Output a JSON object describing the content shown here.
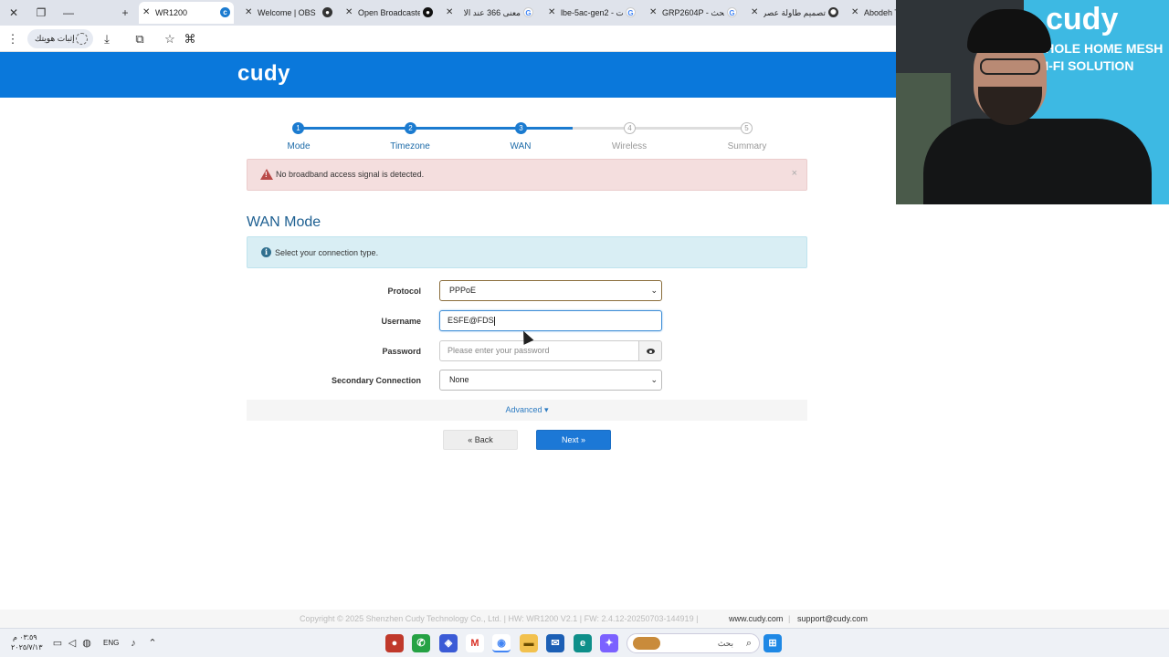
{
  "browser": {
    "tabs": [
      {
        "title": "WR1200",
        "active": true,
        "favicon": "cudy-icon"
      },
      {
        "title": "Welcome | OBS",
        "active": false,
        "favicon": "obs-icon"
      },
      {
        "title": "Open Broadcaste",
        "active": false,
        "favicon": "github-icon"
      },
      {
        "title": "معنی 366 عند الا",
        "active": false,
        "favicon": "google-icon"
      },
      {
        "title": "lbe-5ac-gen2 - ت",
        "active": false,
        "favicon": "google-icon"
      },
      {
        "title": "GRP2604P - بحث",
        "active": false,
        "favicon": "google-icon"
      },
      {
        "title": "تصميم طاولة عصر",
        "active": false,
        "favicon": "openai-icon"
      },
      {
        "title": "Abodeh T",
        "active": false,
        "favicon": "none"
      }
    ],
    "new_tab": "+",
    "toolbar": {
      "identity_label": "إثبات هويتك"
    }
  },
  "header": {
    "logo": "cudy",
    "accent": "#0a78db"
  },
  "stepper": {
    "steps": [
      {
        "num": "1",
        "label": "Mode",
        "done": true
      },
      {
        "num": "2",
        "label": "Timezone",
        "done": true
      },
      {
        "num": "3",
        "label": "WAN",
        "done": true
      },
      {
        "num": "4",
        "label": "Wireless",
        "done": false
      },
      {
        "num": "5",
        "label": "Summary",
        "done": false
      }
    ]
  },
  "alert_danger": {
    "message": "No broadband access signal is detected.",
    "close": "×"
  },
  "page_title": "WAN Mode",
  "alert_info": {
    "message": "Select your connection type."
  },
  "form": {
    "protocol": {
      "label": "Protocol",
      "value": "PPPoE"
    },
    "username": {
      "label": "Username",
      "value": "ESFE@FDS"
    },
    "password": {
      "label": "Password",
      "placeholder": "Please enter your password"
    },
    "secondary": {
      "label": "Secondary Connection",
      "value": "None"
    },
    "advanced": "Advanced ▾",
    "back": "« Back",
    "next": "Next »"
  },
  "footer": {
    "copyright": "Copyright © 2025 Shenzhen Cudy Technology Co., Ltd.  |  HW: WR1200 V2.1  |  FW: 2.4.12-20250703-144919  |",
    "website": "www.cudy.com",
    "separator": "|",
    "email": "support@cudy.com"
  },
  "taskbar": {
    "time": "٠٣:٥٩ م",
    "date": "٢٠٢٥/٧/١٣",
    "language": "ENG",
    "search_label": "بحث"
  },
  "webcam": {
    "brand": "cudy",
    "slogan_line1": "WHOLE HOME MESH",
    "slogan_line2": "WI-FI SOLUTION"
  }
}
